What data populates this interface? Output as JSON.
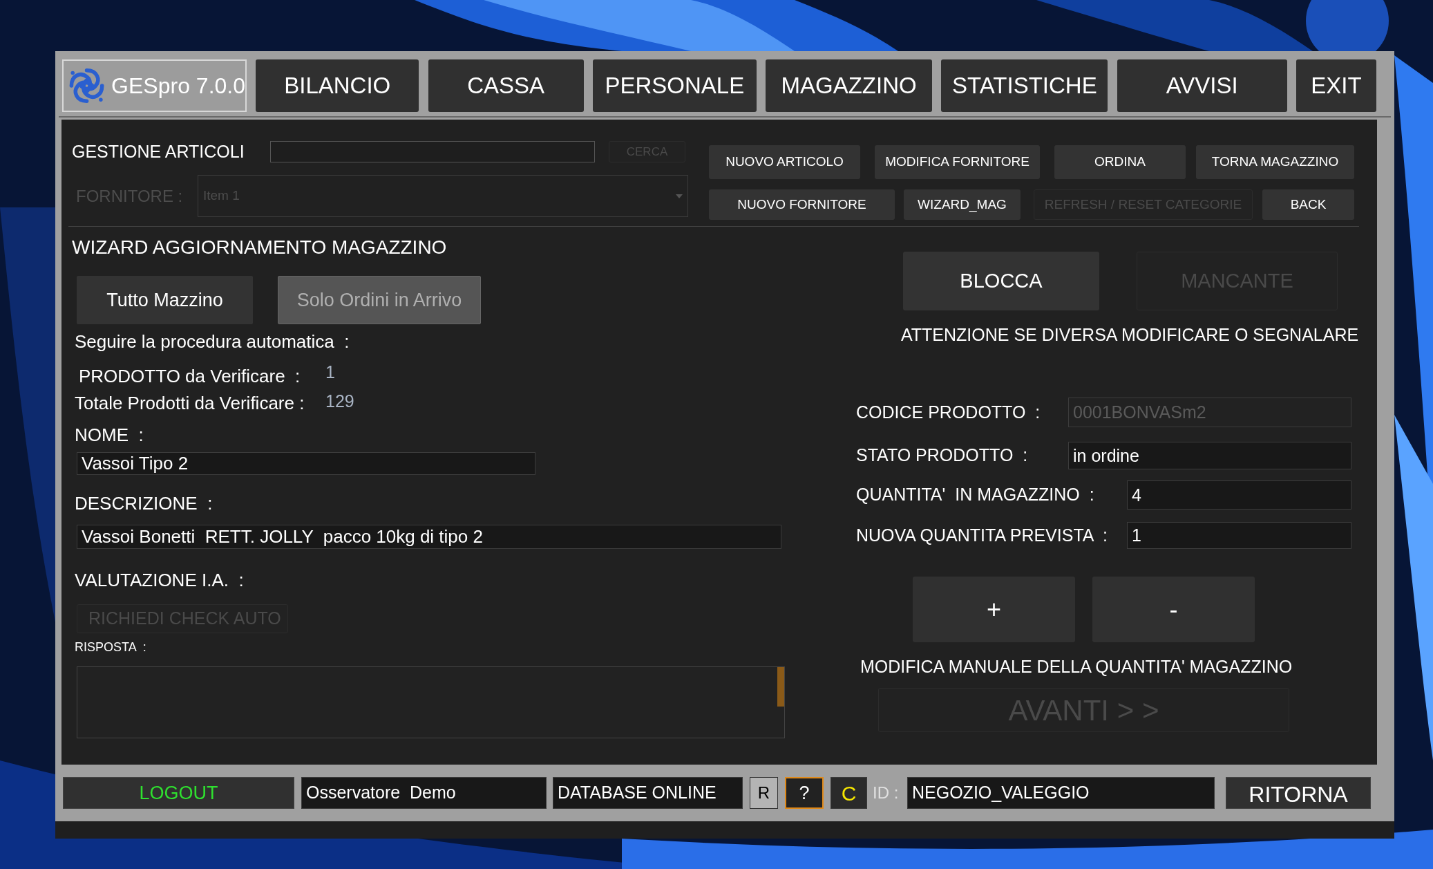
{
  "nav": {
    "logo_label": "GESpro 7.0.0",
    "buttons": [
      "BILANCIO",
      "CASSA",
      "PERSONALE",
      "MAGAZZINO",
      "STATISTICHE",
      "AVVISI",
      "EXIT"
    ]
  },
  "articoli": {
    "title": "GESTIONE ARTICOLI",
    "search_button": {
      "label": "CERCA",
      "disabled": true
    },
    "fornitore": {
      "label": "FORNITORE :",
      "value": "Item 1",
      "disabled": true
    },
    "actions": [
      {
        "label": "NUOVO ARTICOLO",
        "disabled": false
      },
      {
        "label": "MODIFICA FORNITORE",
        "disabled": false
      },
      {
        "label": "ORDINA",
        "disabled": false
      },
      {
        "label": "TORNA MAGAZZINO",
        "disabled": false
      },
      {
        "label": "NUOVO FORNITORE",
        "disabled": false
      },
      {
        "label": "WIZARD_MAG",
        "disabled": false
      },
      {
        "label": "REFRESH / RESET CATEGORIE",
        "disabled": true
      },
      {
        "label": "BACK",
        "disabled": false
      }
    ]
  },
  "wizard": {
    "title": "WIZARD AGGIORNAMENTO MAGAZZINO",
    "modes": [
      {
        "label": "Tutto Mazzino",
        "selected": false
      },
      {
        "label": "Solo Ordini in Arrivo",
        "selected": true
      }
    ],
    "instruction": "Seguire la procedura automatica  :",
    "counters": [
      {
        "label": "PRODOTTO da Verificare  :",
        "value": "1"
      },
      {
        "label": "Totale Prodotti da Verificare :",
        "value": "129"
      }
    ],
    "nome": {
      "label": "NOME  :",
      "value": "Vassoi Tipo 2"
    },
    "descrizione": {
      "label": "DESCRIZIONE  :",
      "value": "Vassoi Bonetti  RETT. JOLLY  pacco 10kg di tipo 2"
    },
    "valutazione_label": "VALUTAZIONE I.A.  :",
    "check_button": {
      "label": "RICHIEDI CHECK AUTO",
      "disabled": true
    },
    "risposta_label": "RISPOSTA  :"
  },
  "product": {
    "actions": [
      {
        "label": "BLOCCA",
        "disabled": false
      },
      {
        "label": "MANCANTE",
        "disabled": true
      }
    ],
    "warning": "ATTENZIONE SE DIVERSA MODIFICARE O SEGNALARE",
    "fields": [
      {
        "label": "CODICE PRODOTTO  :",
        "value": "0001BONVASm2",
        "disabled": true
      },
      {
        "label": "STATO PRODOTTO  :",
        "value": "in ordine",
        "disabled": false
      },
      {
        "label": "QUANTITA'  IN MAGAZZINO  :",
        "value": "4",
        "disabled": false
      },
      {
        "label": "NUOVA QUANTITA PREVISTA  :",
        "value": "1",
        "disabled": false
      }
    ],
    "adjust_buttons": [
      "+",
      "-"
    ],
    "manual_note": "MODIFICA MANUALE DELLA QUANTITA' MAGAZZINO",
    "next_button": {
      "label": "AVANTI > >",
      "disabled": true
    }
  },
  "status_bar": {
    "logout": "LOGOUT",
    "user": "Osservatore  Demo",
    "database": "DATABASE ONLINE",
    "r_button": "R",
    "help_button": "?",
    "c_button": "C",
    "id_label": "ID :",
    "id_value": "NEGOZIO_VALEGGIO",
    "back_button": "RITORNA"
  }
}
